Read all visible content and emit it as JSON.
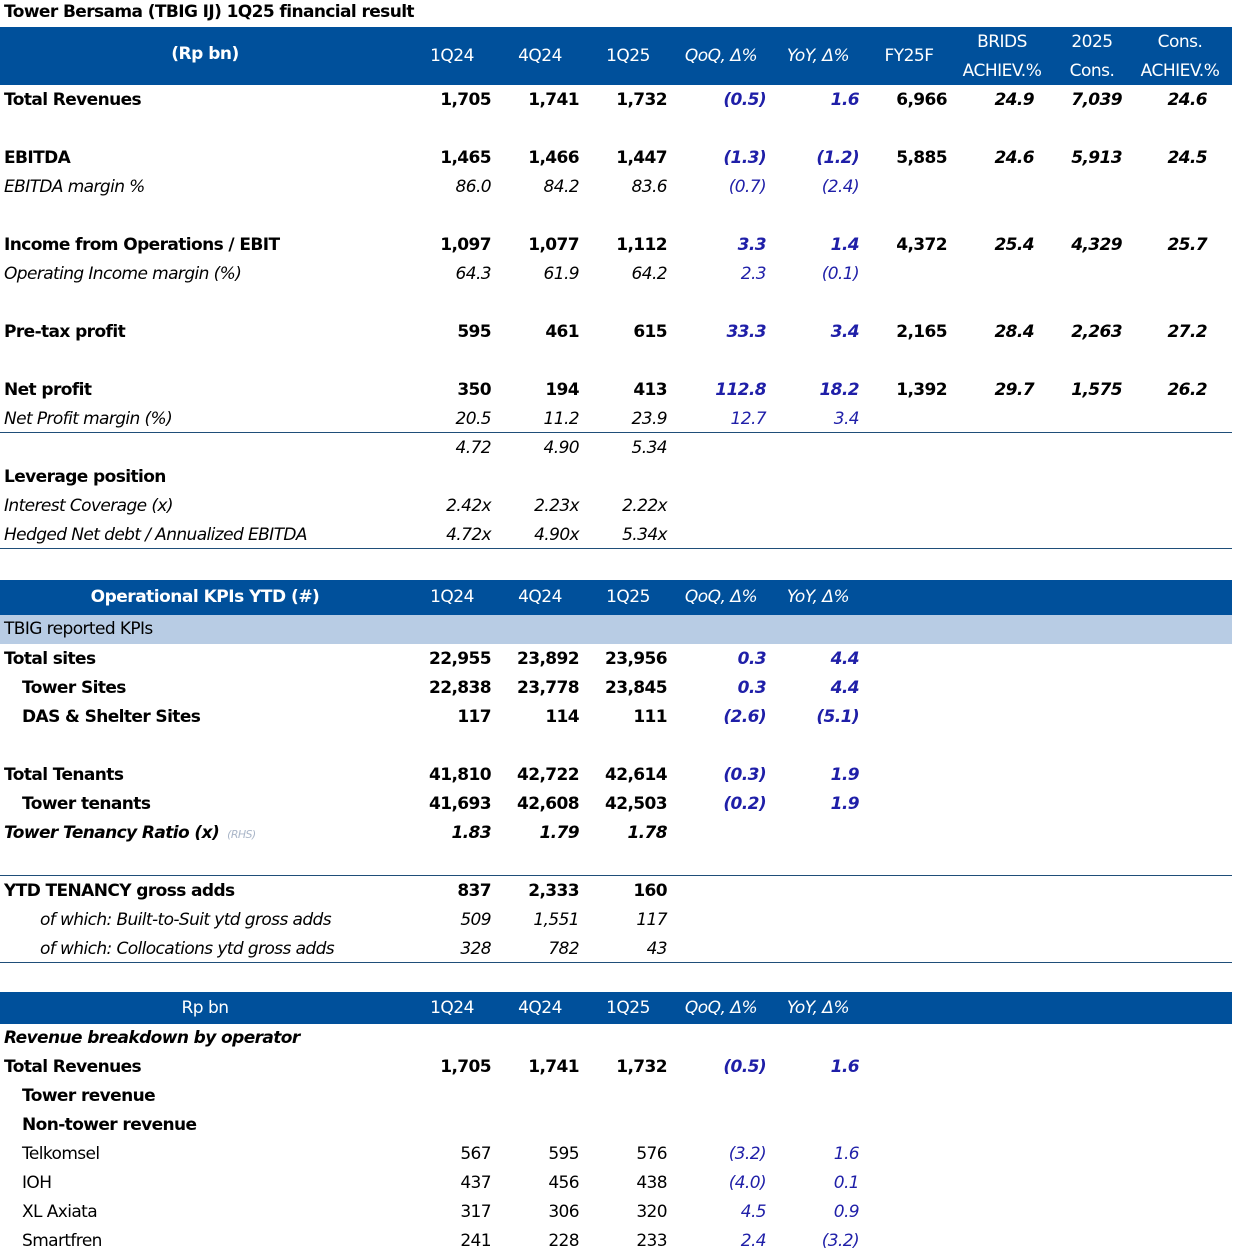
{
  "title": "Tower Bersama (TBIG IJ) 1Q25 financial result",
  "fin_header": {
    "label": "(Rp bn)",
    "q1": "1Q24",
    "q2": "4Q24",
    "q3": "1Q25",
    "qoq": "QoQ, Δ%",
    "yoy": "YoY, Δ%",
    "fy": "FY25F",
    "brids1": "BRIDS",
    "brids2": "ACHIEV.%",
    "cons1": "2025",
    "cons2": "Cons.",
    "ach1": "Cons.",
    "ach2": "ACHIEV.%"
  },
  "fin": {
    "total_revenues": {
      "label": "Total Revenues",
      "v1": "1,705",
      "v2": "1,741",
      "v3": "1,732",
      "qoq": "(0.5)",
      "yoy": "1.6",
      "fy": "6,966",
      "brids": "24.9",
      "cons": "7,039",
      "ach": "24.6"
    },
    "ebitda": {
      "label": "EBITDA",
      "v1": "1,465",
      "v2": "1,466",
      "v3": "1,447",
      "qoq": "(1.3)",
      "yoy": "(1.2)",
      "fy": "5,885",
      "brids": "24.6",
      "cons": "5,913",
      "ach": "24.5"
    },
    "ebitda_margin": {
      "label": "EBITDA margin %",
      "v1": "86.0",
      "v2": "84.2",
      "v3": "83.6",
      "qoq": "(0.7)",
      "yoy": "(2.4)"
    },
    "ebit": {
      "label": "Income from Operations / EBIT",
      "v1": "1,097",
      "v2": "1,077",
      "v3": "1,112",
      "qoq": "3.3",
      "yoy": "1.4",
      "fy": "4,372",
      "brids": "25.4",
      "cons": "4,329",
      "ach": "25.7"
    },
    "op_margin": {
      "label": "Operating Income margin (%)",
      "v1": "64.3",
      "v2": "61.9",
      "v3": "64.2",
      "qoq": "2.3",
      "yoy": "(0.1)"
    },
    "pretax": {
      "label": "Pre-tax profit",
      "v1": "595",
      "v2": "461",
      "v3": "615",
      "qoq": "33.3",
      "yoy": "3.4",
      "fy": "2,165",
      "brids": "28.4",
      "cons": "2,263",
      "ach": "27.2"
    },
    "net_profit": {
      "label": "Net profit",
      "v1": "350",
      "v2": "194",
      "v3": "413",
      "qoq": "112.8",
      "yoy": "18.2",
      "fy": "1,392",
      "brids": "29.7",
      "cons": "1,575",
      "ach": "26.2"
    },
    "net_margin": {
      "label": "Net Profit margin (%)",
      "v1": "20.5",
      "v2": "11.2",
      "v3": "23.9",
      "qoq": "12.7",
      "yoy": "3.4"
    },
    "extra": {
      "v1": "4.72",
      "v2": "4.90",
      "v3": "5.34"
    },
    "leverage": {
      "label": "Leverage position"
    },
    "interest_cov": {
      "label": "Interest Coverage (x)",
      "v1": "2.42x",
      "v2": "2.23x",
      "v3": "2.22x"
    },
    "hedged": {
      "label": "Hedged Net debt / Annualized EBITDA",
      "v1": "4.72x",
      "v2": "4.90x",
      "v3": "5.34x"
    }
  },
  "kpi_header": {
    "label": "Operational KPIs YTD (#)",
    "q1": "1Q24",
    "q2": "4Q24",
    "q3": "1Q25",
    "qoq": "QoQ, Δ%",
    "yoy": "YoY, Δ%"
  },
  "kpi_sub": "TBIG reported KPIs",
  "kpi": {
    "total_sites": {
      "label": "Total  sites",
      "v1": "22,955",
      "v2": "23,892",
      "v3": "23,956",
      "qoq": "0.3",
      "yoy": "4.4"
    },
    "tower_sites": {
      "label": "Tower Sites",
      "v1": "22,838",
      "v2": "23,778",
      "v3": "23,845",
      "qoq": "0.3",
      "yoy": "4.4"
    },
    "das": {
      "label": "DAS & Shelter Sites",
      "v1": "117",
      "v2": "114",
      "v3": "111",
      "qoq": "(2.6)",
      "yoy": "(5.1)"
    },
    "total_tenants": {
      "label": "Total Tenants",
      "v1": "41,810",
      "v2": "42,722",
      "v3": "42,614",
      "qoq": "(0.3)",
      "yoy": "1.9"
    },
    "tower_tenants": {
      "label": "Tower tenants",
      "v1": "41,693",
      "v2": "42,608",
      "v3": "42,503",
      "qoq": "(0.2)",
      "yoy": "1.9"
    },
    "tenancy_ratio": {
      "label": "Tower Tenancy Ratio (x)",
      "note": "(RHS)",
      "v1": "1.83",
      "v2": "1.79",
      "v3": "1.78"
    },
    "gross_adds": {
      "label": "YTD TENANCY gross adds",
      "v1": "837",
      "v2": "2,333",
      "v3": "160"
    },
    "bts": {
      "label": "of which: Built-to-Suit ytd gross adds",
      "v1": "509",
      "v2": "1,551",
      "v3": "117"
    },
    "colo": {
      "label": "of which: Collocations ytd gross adds",
      "v1": "328",
      "v2": "782",
      "v3": "43"
    }
  },
  "rev_header": {
    "label": "Rp bn",
    "q1": "1Q24",
    "q2": "4Q24",
    "q3": "1Q25",
    "qoq": "QoQ, Δ%",
    "yoy": "YoY, Δ%"
  },
  "rev": {
    "section": {
      "label": "Revenue breakdown by operator"
    },
    "total": {
      "label": "Total Revenues",
      "v1": "1,705",
      "v2": "1,741",
      "v3": "1,732",
      "qoq": "(0.5)",
      "yoy": "1.6"
    },
    "tower": {
      "label": "Tower revenue"
    },
    "nontower": {
      "label": "Non-tower revenue"
    },
    "telkomsel": {
      "label": "Telkomsel",
      "v1": "567",
      "v2": "595",
      "v3": "576",
      "qoq": "(3.2)",
      "yoy": "1.6"
    },
    "ioh": {
      "label": "IOH",
      "v1": "437",
      "v2": "456",
      "v3": "438",
      "qoq": "(4.0)",
      "yoy": "0.1"
    },
    "xl": {
      "label": "XL Axiata",
      "v1": "317",
      "v2": "306",
      "v3": "320",
      "qoq": "4.5",
      "yoy": "0.9"
    },
    "smartfren": {
      "label": "Smartfren",
      "v1": "241",
      "v2": "228",
      "v3": "233",
      "qoq": "2.4",
      "yoy": "(3.2)"
    }
  }
}
